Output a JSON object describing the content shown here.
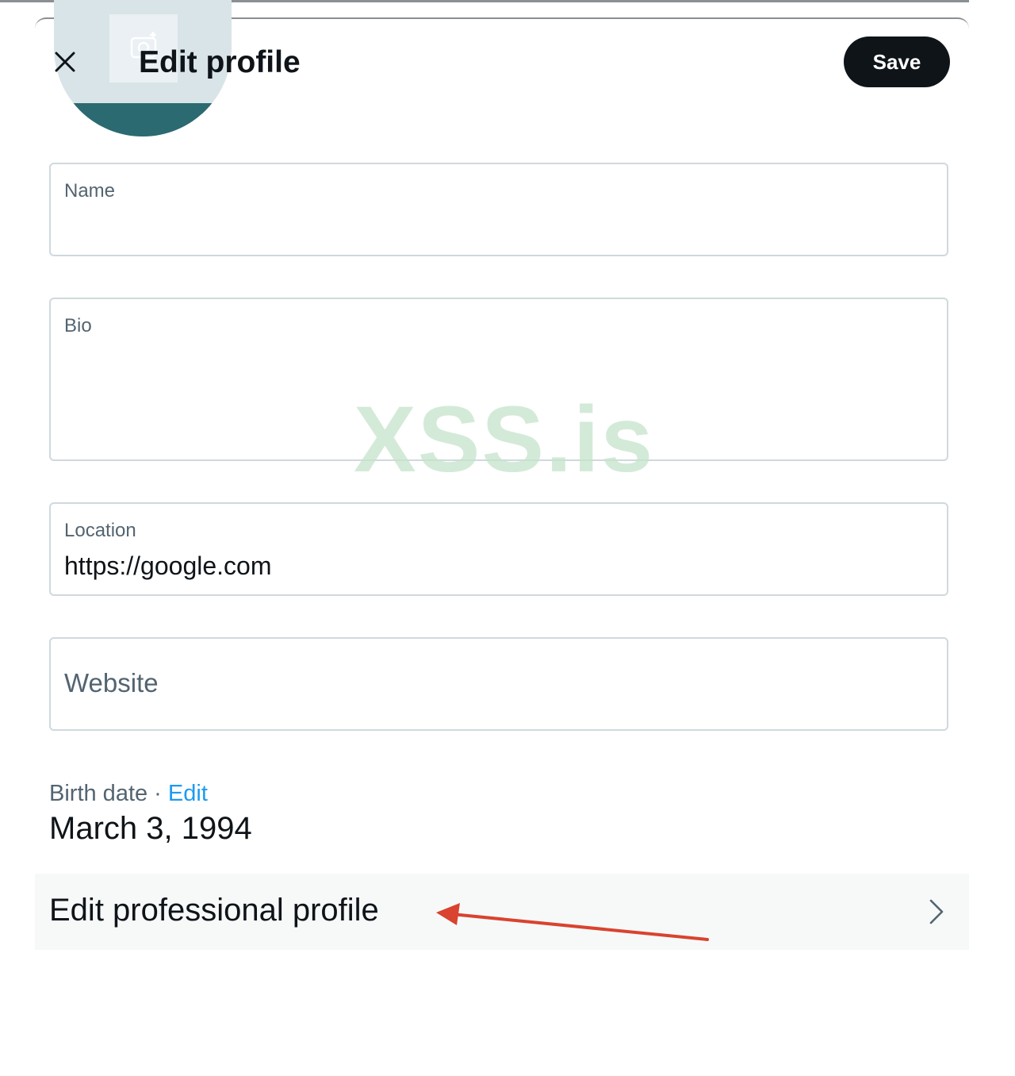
{
  "header": {
    "title": "Edit profile",
    "save_label": "Save"
  },
  "fields": {
    "name": {
      "label": "Name",
      "value": ""
    },
    "bio": {
      "label": "Bio",
      "value": ""
    },
    "location": {
      "label": "Location",
      "value": "https://google.com"
    },
    "website": {
      "placeholder": "Website",
      "value": ""
    }
  },
  "birth_date": {
    "label": "Birth date · ",
    "edit_label": "Edit",
    "value": "March 3, 1994"
  },
  "professional": {
    "label": "Edit professional profile"
  },
  "watermark": {
    "text": "XSS.is"
  },
  "icons": {
    "close": "close-icon",
    "chevron": "chevron-right-icon",
    "camera": "camera-icon",
    "annotation": "red-arrow-annotation"
  },
  "colors": {
    "primary_text": "#0f1419",
    "secondary_text": "#536471",
    "accent": "#1d9bf0",
    "save_bg": "#0f1419",
    "field_border": "#cfd9de",
    "row_bg": "#f7f9f9",
    "arrow": "#d9432f",
    "watermark": "#c5e4cb"
  }
}
